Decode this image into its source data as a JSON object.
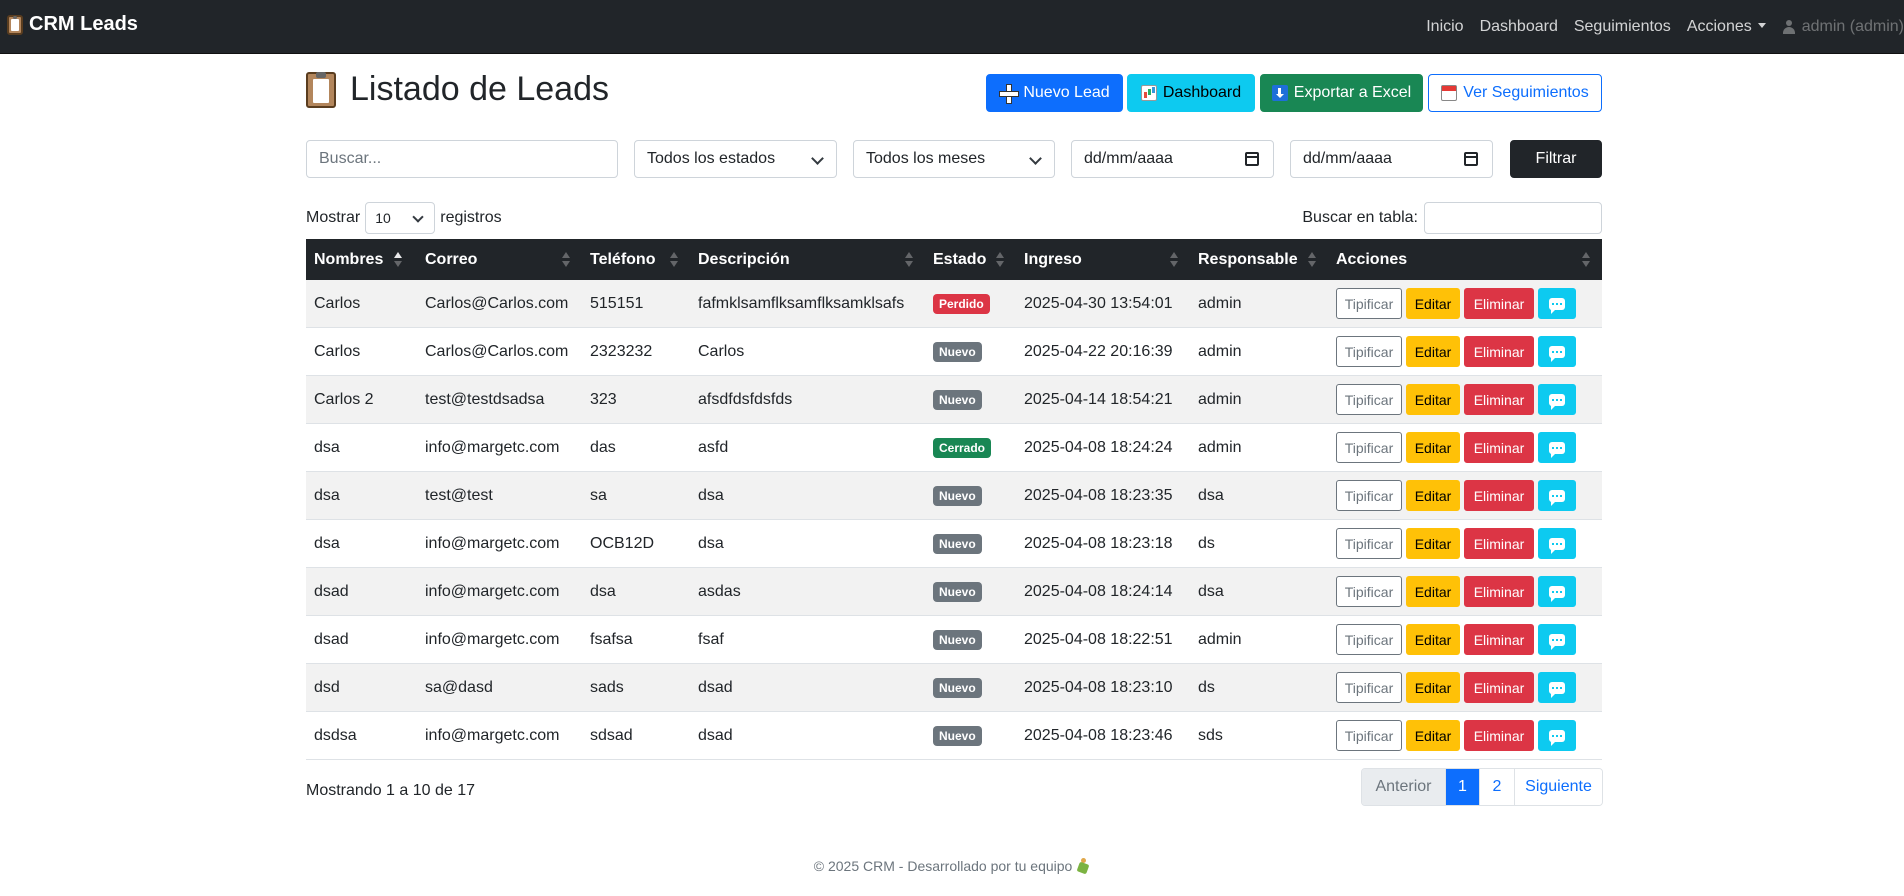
{
  "navbar": {
    "brand": "CRM Leads",
    "links": [
      "Inicio",
      "Dashboard",
      "Seguimientos",
      "Acciones"
    ],
    "user": "admin (admin)"
  },
  "header": {
    "title": "Listado de Leads",
    "buttons": {
      "nuevo": "Nuevo Lead",
      "dashboard": "Dashboard",
      "exportar": "Exportar a Excel",
      "seguimientos": "Ver Seguimientos"
    }
  },
  "filters": {
    "search_placeholder": "Buscar...",
    "estado": "Todos los estados",
    "mes": "Todos los meses",
    "fecha_desde": "dd/mm/aaaa",
    "fecha_hasta": "dd/mm/aaaa",
    "filtrar": "Filtrar"
  },
  "datatable": {
    "mostrar": "Mostrar",
    "length": "10",
    "registros": "registros",
    "search_label": "Buscar en tabla:",
    "info": "Mostrando 1 a 10 de 17",
    "pagination": [
      "Anterior",
      "1",
      "2",
      "Siguiente"
    ],
    "active_page": "1"
  },
  "table": {
    "columns": [
      "Nombres",
      "Correo",
      "Teléfono",
      "Descripción",
      "Estado",
      "Ingreso",
      "Responsable",
      "Acciones"
    ],
    "actions": {
      "tipificar": "Tipificar",
      "editar": "Editar",
      "eliminar": "Eliminar"
    },
    "status_colors": {
      "Perdido": "#dc3545",
      "Nuevo": "#6c757d",
      "Cerrado": "#198754"
    },
    "rows": [
      {
        "nombres": "Carlos",
        "correo": "Carlos@Carlos.com",
        "telefono": "515151",
        "descripcion": "fafmklsamflksamflksamklsafs",
        "estado": "Perdido",
        "ingreso": "2025-04-30 13:54:01",
        "responsable": "admin"
      },
      {
        "nombres": "Carlos",
        "correo": "Carlos@Carlos.com",
        "telefono": "2323232",
        "descripcion": "Carlos",
        "estado": "Nuevo",
        "ingreso": "2025-04-22 20:16:39",
        "responsable": "admin"
      },
      {
        "nombres": "Carlos 2",
        "correo": "test@testdsadsa",
        "telefono": "323",
        "descripcion": "afsdfdsfdsfds",
        "estado": "Nuevo",
        "ingreso": "2025-04-14 18:54:21",
        "responsable": "admin"
      },
      {
        "nombres": "dsa",
        "correo": "info@margetc.com",
        "telefono": "das",
        "descripcion": "asfd",
        "estado": "Cerrado",
        "ingreso": "2025-04-08 18:24:24",
        "responsable": "admin"
      },
      {
        "nombres": "dsa",
        "correo": "test@test",
        "telefono": "sa",
        "descripcion": "dsa",
        "estado": "Nuevo",
        "ingreso": "2025-04-08 18:23:35",
        "responsable": "dsa"
      },
      {
        "nombres": "dsa",
        "correo": "info@margetc.com",
        "telefono": "OCB12D",
        "descripcion": "dsa",
        "estado": "Nuevo",
        "ingreso": "2025-04-08 18:23:18",
        "responsable": "ds"
      },
      {
        "nombres": "dsad",
        "correo": "info@margetc.com",
        "telefono": "dsa",
        "descripcion": "asdas",
        "estado": "Nuevo",
        "ingreso": "2025-04-08 18:24:14",
        "responsable": "dsa"
      },
      {
        "nombres": "dsad",
        "correo": "info@margetc.com",
        "telefono": "fsafsa",
        "descripcion": "fsaf",
        "estado": "Nuevo",
        "ingreso": "2025-04-08 18:22:51",
        "responsable": "admin"
      },
      {
        "nombres": "dsd",
        "correo": "sa@dasd",
        "telefono": "sads",
        "descripcion": "dsad",
        "estado": "Nuevo",
        "ingreso": "2025-04-08 18:23:10",
        "responsable": "ds"
      },
      {
        "nombres": "dsdsa",
        "correo": "info@margetc.com",
        "telefono": "sdsad",
        "descripcion": "dsad",
        "estado": "Nuevo",
        "ingreso": "2025-04-08 18:23:46",
        "responsable": "sds"
      }
    ]
  },
  "footer": {
    "text": "© 2025 CRM - Desarrollado por tu equipo"
  }
}
